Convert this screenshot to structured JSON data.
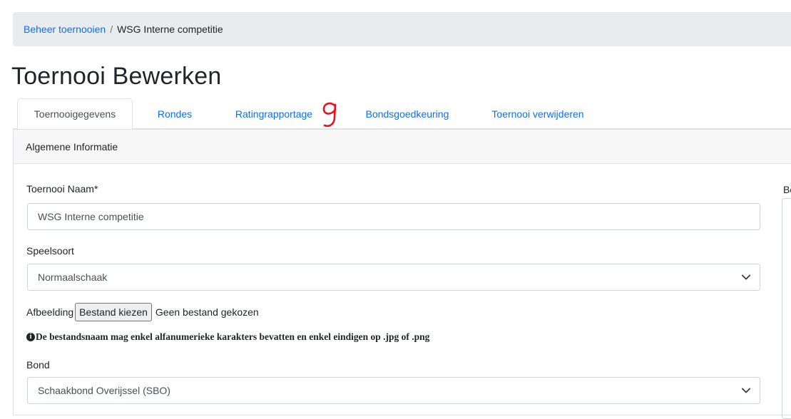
{
  "breadcrumb": {
    "parent": "Beheer toernooien",
    "separator": "/",
    "current": "WSG Interne competitie"
  },
  "page": {
    "title": "Toernooi Bewerken"
  },
  "tabs": [
    {
      "label": "Toernooigegevens",
      "active": true
    },
    {
      "label": "Rondes"
    },
    {
      "label": "Ratingrapportage"
    },
    {
      "label": "Bondsgoedkeuring"
    },
    {
      "label": "Toernooi verwijderen"
    }
  ],
  "annotation": {
    "mark": "9",
    "color": "#e8101f"
  },
  "card": {
    "header": "Algemene Informatie"
  },
  "form": {
    "name_label": "Toernooi Naam*",
    "name_value": "WSG Interne competitie",
    "speelsoort_label": "Speelsoort",
    "speelsoort_value": "Normaalschaak",
    "image_label": "Afbeelding",
    "file_button": "Bestand kiezen",
    "file_status": "Geen bestand gekozen",
    "file_note": "De bestandsnaam mag enkel alfanumerieke karakters bevatten en enkel eindigen op .jpg of .png",
    "bond_label": "Bond",
    "bond_value": "Schaakbond Overijssel (SBO)",
    "right_label": "Be"
  },
  "colors": {
    "link": "#0d6efd",
    "breadcrumb_bg": "#e9ecef",
    "header_bg": "#f7f7f7"
  },
  "icons": {
    "select_arrow": "chevron-down-icon",
    "info": "info-circle-icon"
  }
}
